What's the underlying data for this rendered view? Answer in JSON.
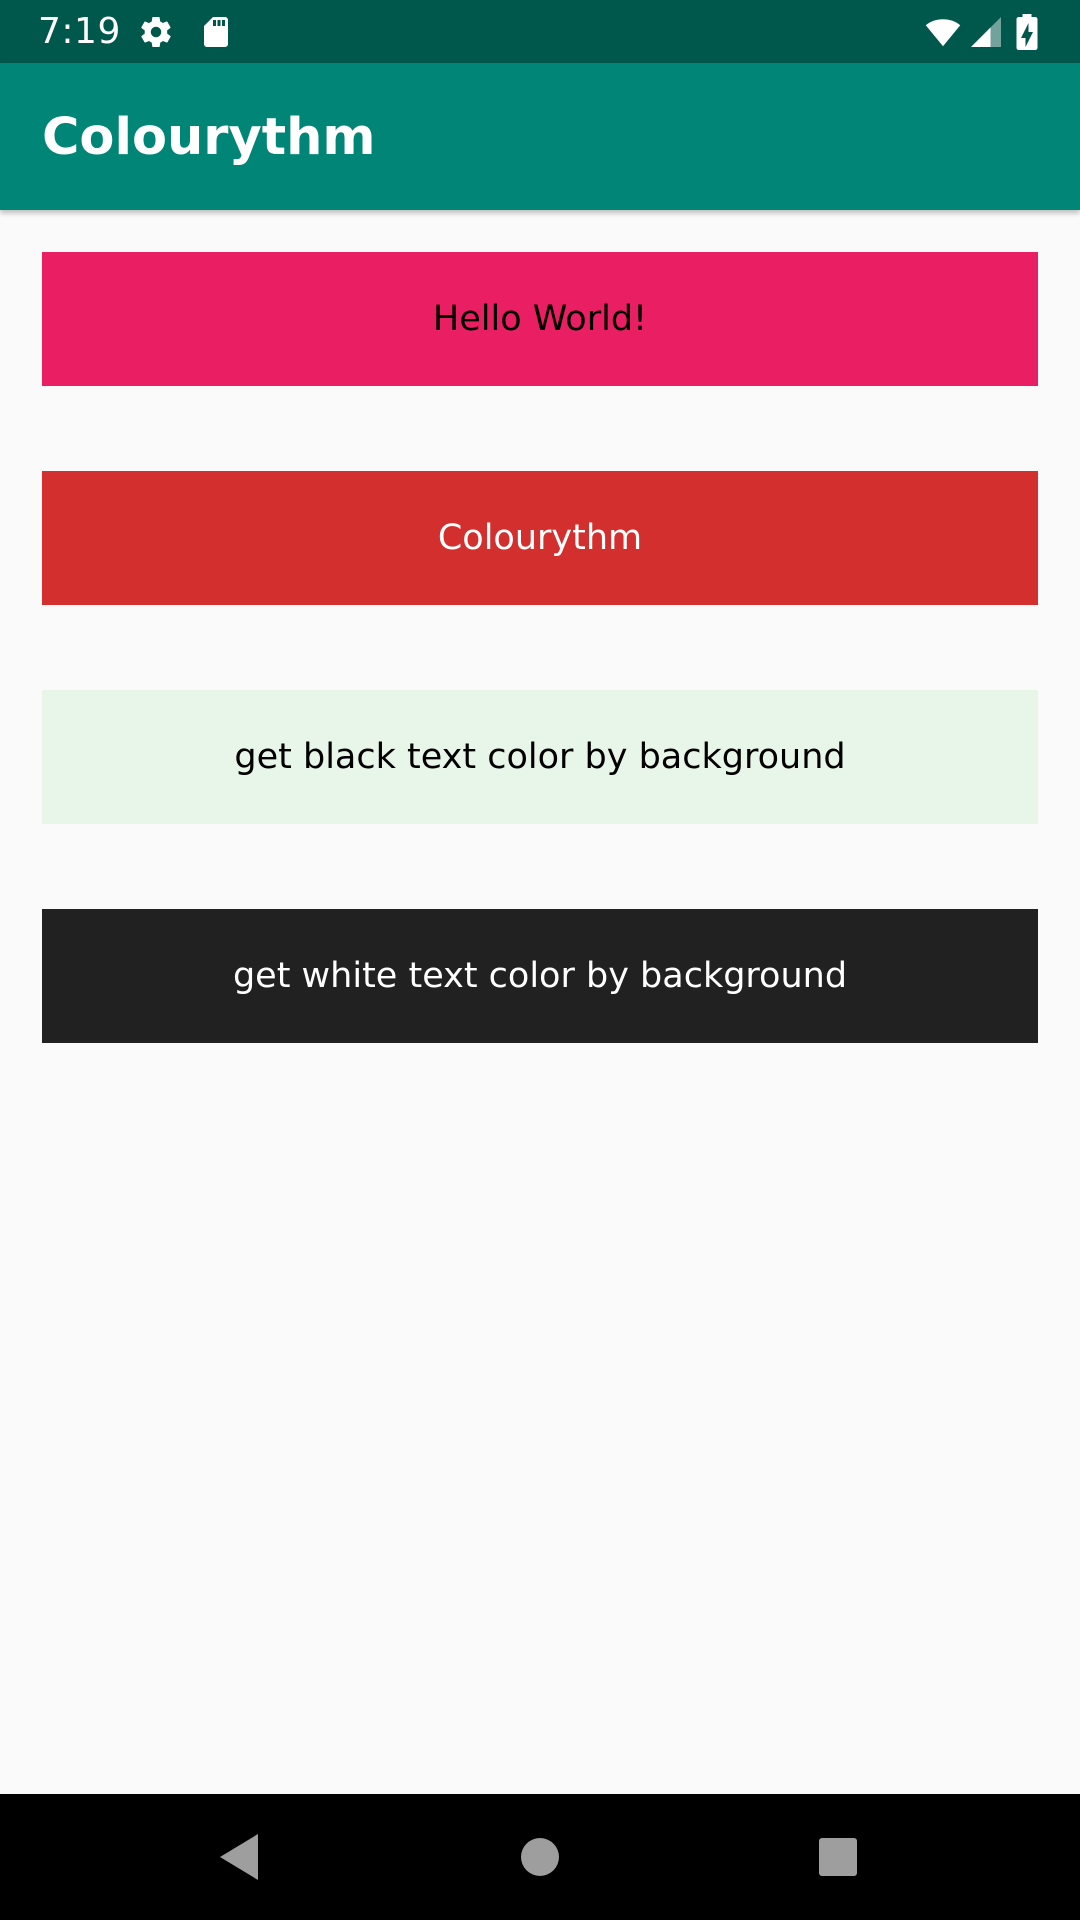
{
  "status_bar": {
    "time": "7:19",
    "icons": [
      "settings-gear-icon",
      "sd-card-icon",
      "wifi-icon",
      "cell-signal-icon",
      "battery-charging-icon"
    ]
  },
  "app_bar": {
    "title": "Colourythm",
    "color": "#008577"
  },
  "boxes": [
    {
      "text": "Hello World!",
      "background": "#e91e63",
      "text_color": "#000000"
    },
    {
      "text": "Colourythm",
      "background": "#d32f2f",
      "text_color": "#ffffff"
    },
    {
      "text": "get black text color by background",
      "background": "#e8f5e9",
      "text_color": "#000000"
    },
    {
      "text": "get white text color by background",
      "background": "#212121",
      "text_color": "#ffffff"
    }
  ],
  "nav_bar": {
    "icons": [
      "back-icon",
      "home-icon",
      "recents-icon"
    ]
  }
}
